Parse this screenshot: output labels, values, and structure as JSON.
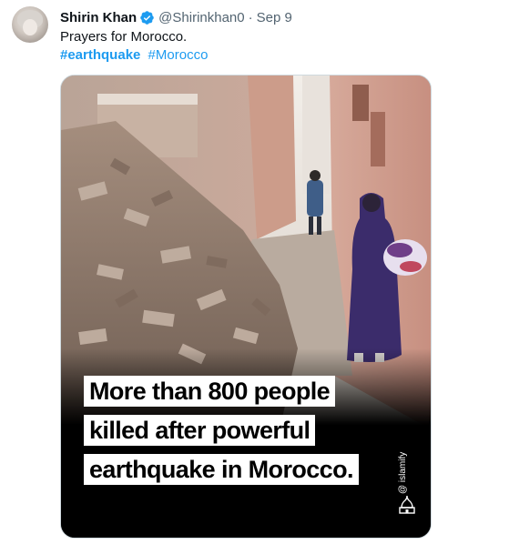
{
  "tweet": {
    "author_name": "Shirin Khan",
    "handle": "@Shirinkhan0",
    "separator": "·",
    "date": "Sep 9",
    "text": "Prayers for Morocco.",
    "hashtags": [
      "#earthquake",
      "#Morocco"
    ],
    "verified_icon": "verified-badge-icon",
    "verified_color": "#1d9bf0"
  },
  "media": {
    "caption_lines": [
      "More than 800 people",
      "killed after powerful",
      "earthquake in Morocco."
    ],
    "watermark": "@ islamify",
    "watermark_icon": "mosque-icon"
  },
  "colors": {
    "link": "#1d9bf0",
    "secondary_text": "#536471",
    "primary_text": "#0f1419"
  }
}
